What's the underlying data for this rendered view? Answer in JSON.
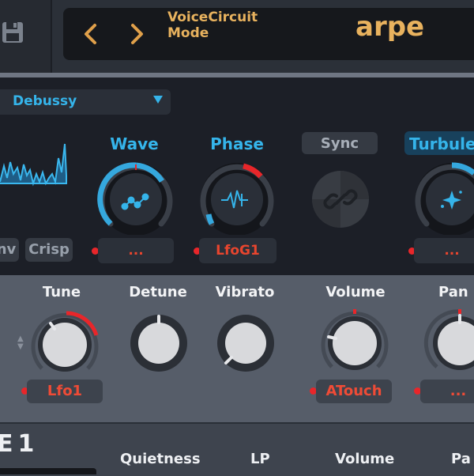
{
  "header": {
    "prev_icon": "chevron-left-icon",
    "next_icon": "chevron-right-icon",
    "mode_line1": "VoiceCircuit",
    "mode_line2": "Mode",
    "preset_name": "arpe",
    "accent": "#e8b25e"
  },
  "osc": {
    "waveform_select": "Debussy",
    "buttons": [
      "nv",
      "Crisp"
    ],
    "knobs": [
      {
        "label": "Wave",
        "mod": "...",
        "icon": "wave-dots-icon"
      },
      {
        "label": "Phase",
        "mod": "LfoG1",
        "icon": "pulse-icon"
      },
      {
        "label": "Sync",
        "icon": "link-icon"
      },
      {
        "label": "Turbulen",
        "mod": "...",
        "icon": "sparkle-icon"
      }
    ]
  },
  "voice": {
    "knobs": [
      {
        "label": "Tune",
        "mod": "Lfo1"
      },
      {
        "label": "Detune"
      },
      {
        "label": "Vibrato"
      },
      {
        "label": "Volume",
        "mod": "ATouch"
      },
      {
        "label": "Pan",
        "mod": "..."
      }
    ]
  },
  "bottom": {
    "title": "E1",
    "labels": [
      "Quietness",
      "LP",
      "Volume",
      "Pa"
    ]
  },
  "colors": {
    "blue": "#35b4ea",
    "red": "#e8262a",
    "mod_text": "#ef4b36"
  }
}
